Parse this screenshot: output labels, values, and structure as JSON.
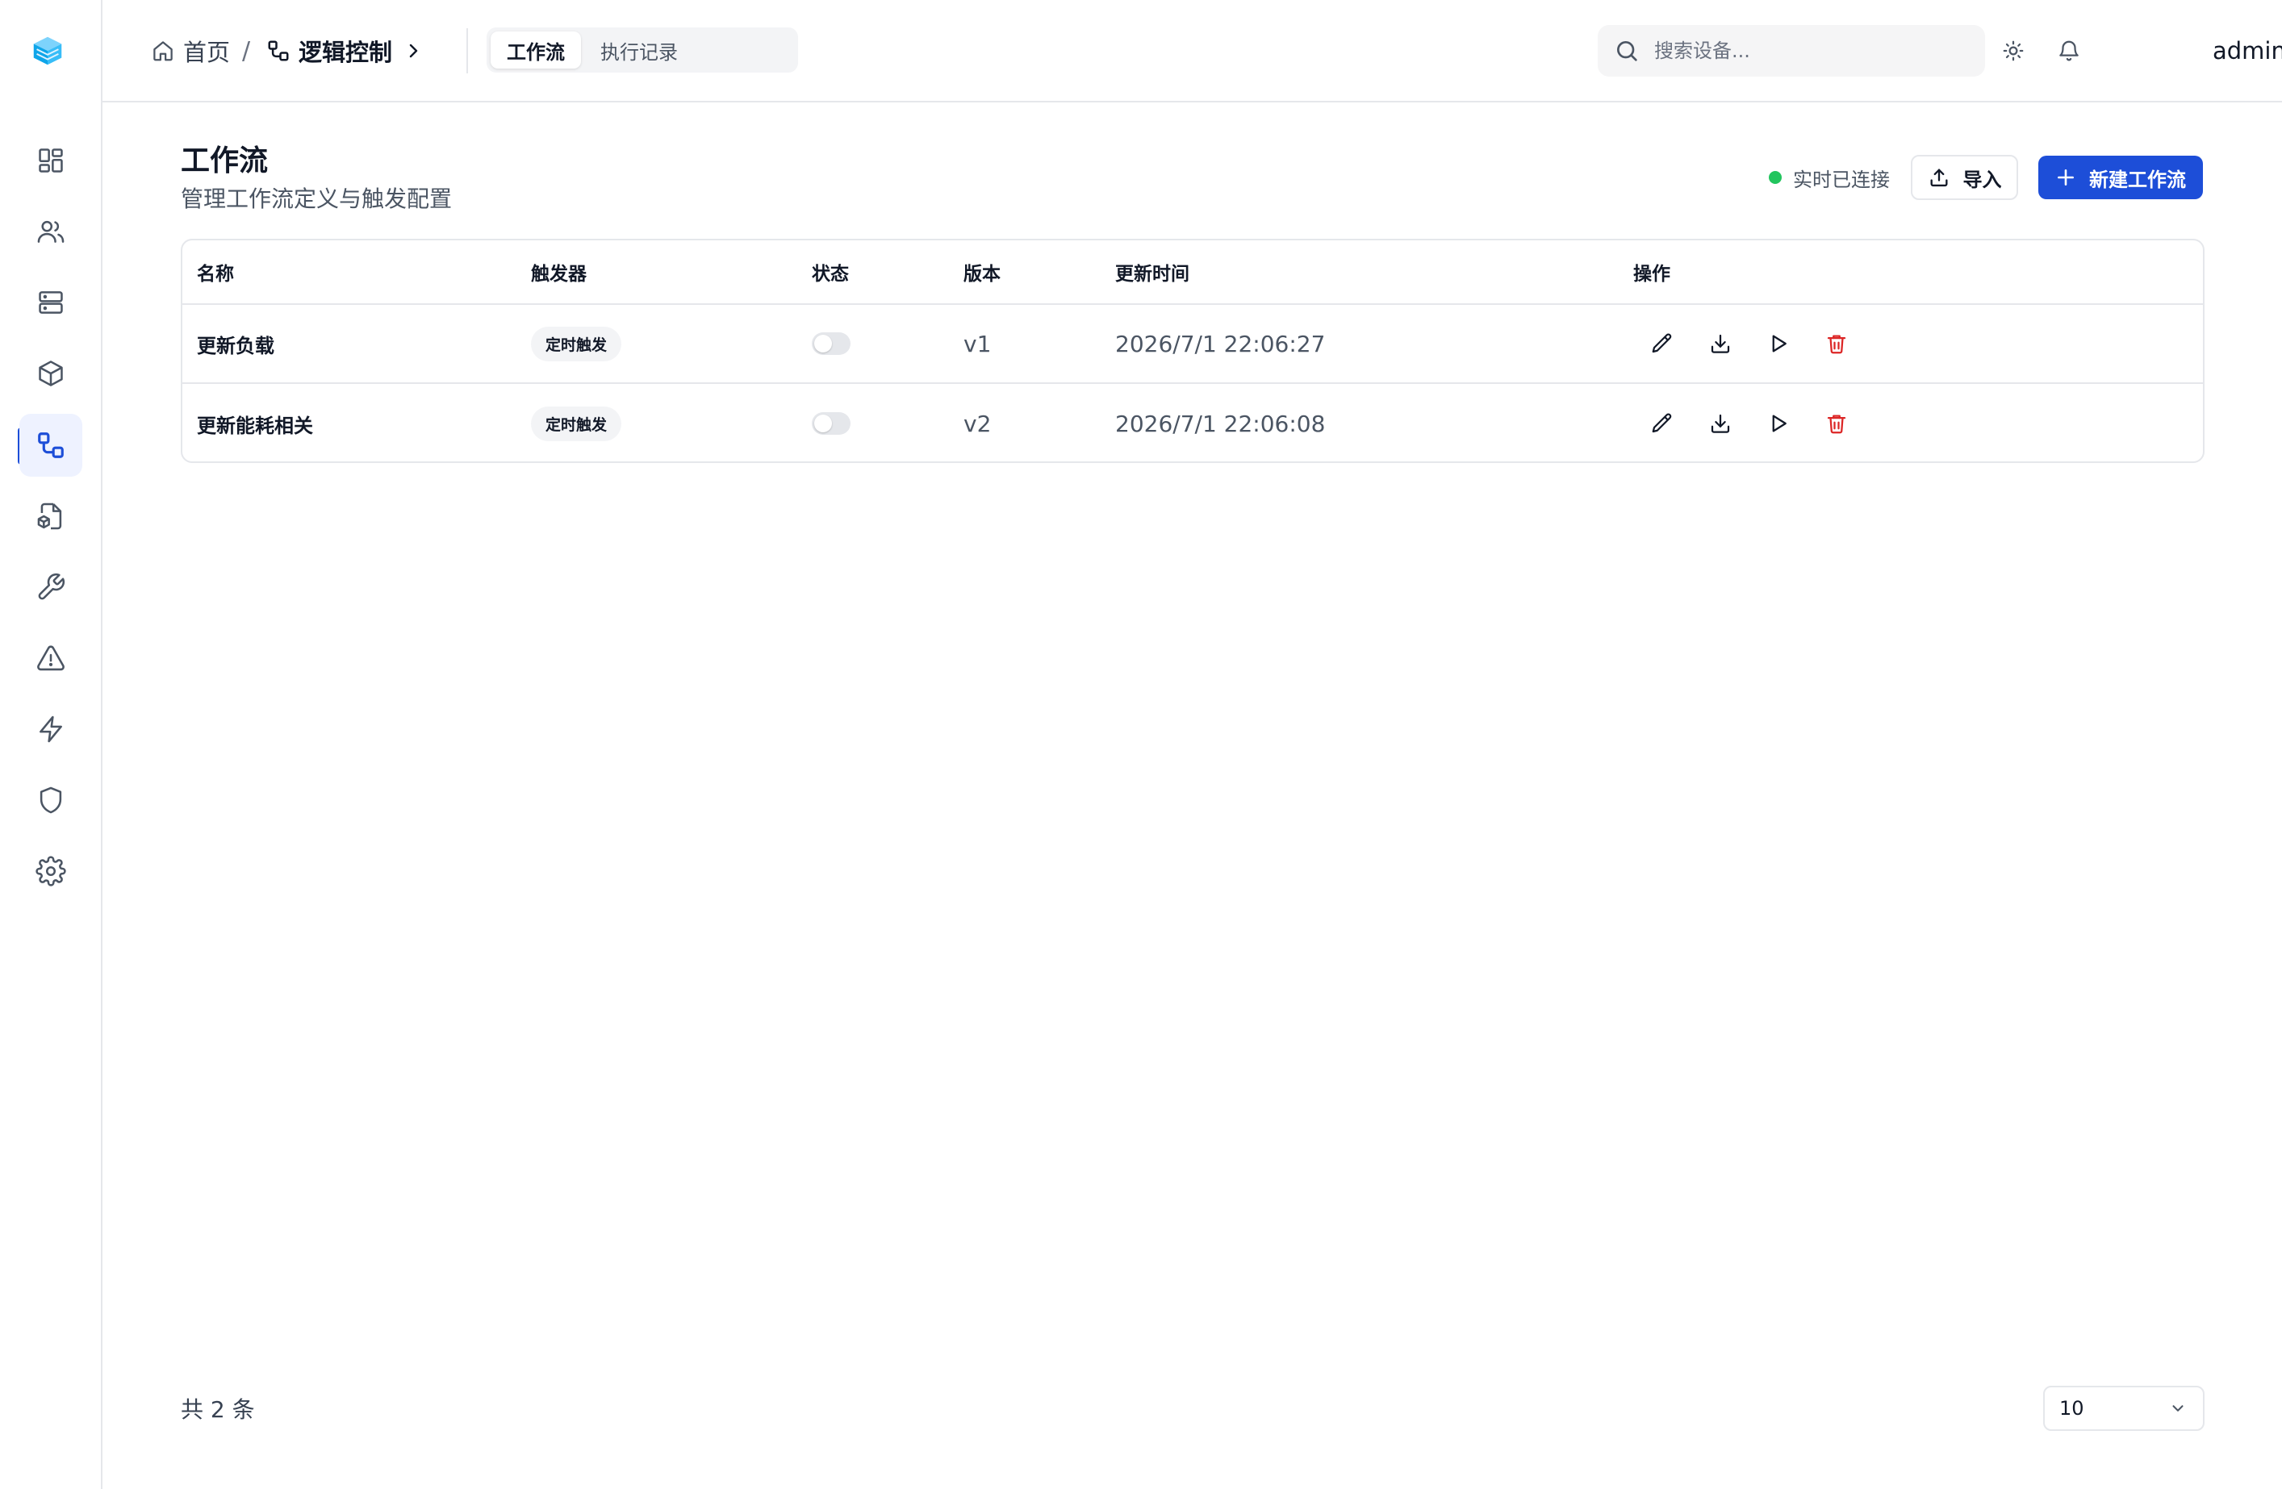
{
  "header": {
    "breadcrumb": {
      "home_label": "首页",
      "separator": "/",
      "current_label": "逻辑控制"
    },
    "tabs": [
      {
        "label": "工作流",
        "active": true
      },
      {
        "label": "执行记录",
        "active": false
      }
    ],
    "search": {
      "placeholder": "搜索设备..."
    },
    "user": {
      "name": "admin"
    }
  },
  "sidebar": {
    "items": [
      {
        "icon": "dashboard-icon",
        "active": false
      },
      {
        "icon": "users-icon",
        "active": false
      },
      {
        "icon": "server-icon",
        "active": false
      },
      {
        "icon": "cube-icon",
        "active": false
      },
      {
        "icon": "workflow-icon",
        "active": true
      },
      {
        "icon": "file-box-icon",
        "active": false
      },
      {
        "icon": "wrench-icon",
        "active": false
      },
      {
        "icon": "alert-triangle-icon",
        "active": false
      },
      {
        "icon": "zap-icon",
        "active": false
      },
      {
        "icon": "shield-icon",
        "active": false
      },
      {
        "icon": "settings-icon",
        "active": false
      }
    ]
  },
  "page": {
    "title": "工作流",
    "subtitle": "管理工作流定义与触发配置",
    "live_status": "实时已连接",
    "import_label": "导入",
    "new_label": "新建工作流"
  },
  "table": {
    "columns": [
      "名称",
      "触发器",
      "状态",
      "版本",
      "更新时间",
      "操作"
    ],
    "rows": [
      {
        "name": "更新负载",
        "trigger": "定时触发",
        "enabled": false,
        "version": "v1",
        "updated": "2026/7/1 22:06:27"
      },
      {
        "name": "更新能耗相关",
        "trigger": "定时触发",
        "enabled": false,
        "version": "v2",
        "updated": "2026/7/1 22:06:08"
      }
    ]
  },
  "footer": {
    "total_text": "共 2 条",
    "page_size": "10"
  },
  "colors": {
    "accent": "#1d4ed8",
    "live_dot": "#22c55e",
    "danger": "#dc2626",
    "border": "#e5e7eb"
  }
}
